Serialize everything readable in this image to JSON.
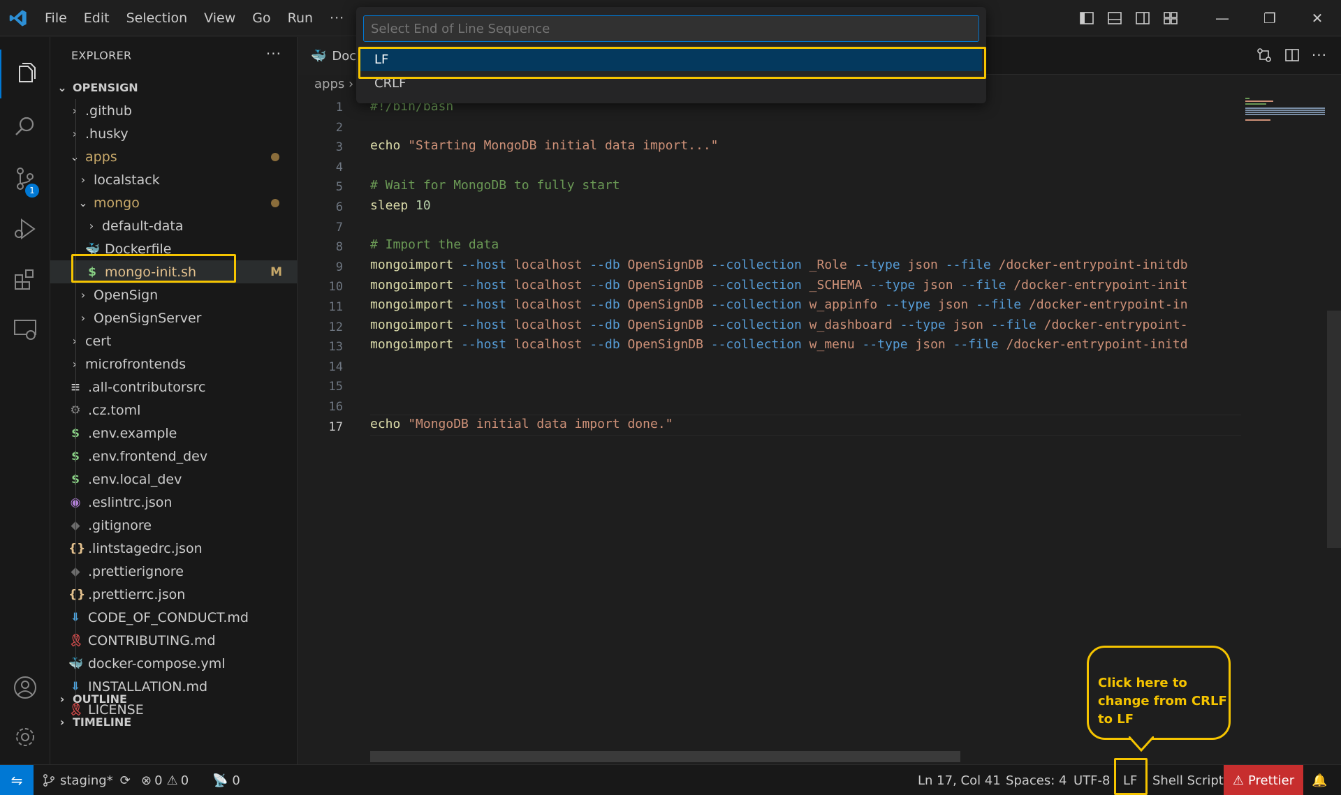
{
  "menu": [
    "File",
    "Edit",
    "Selection",
    "View",
    "Go",
    "Run"
  ],
  "menu_more": "···",
  "window": {
    "minimize": "—",
    "restore": "❐",
    "close": "✕"
  },
  "activity": {
    "scm_badge": "1"
  },
  "sidebar": {
    "title": "EXPLORER",
    "more": "···",
    "root": "OPENSIGN",
    "items": [
      {
        "label": ".github",
        "chev": "›",
        "icon": ""
      },
      {
        "label": ".husky",
        "chev": "›",
        "icon": ""
      },
      {
        "label": "apps",
        "chev": "⌄",
        "icon": ""
      },
      {
        "label": "localstack",
        "chev": "›",
        "icon": ""
      },
      {
        "label": "mongo",
        "chev": "⌄",
        "icon": ""
      },
      {
        "label": "default-data",
        "chev": "›",
        "icon": ""
      },
      {
        "label": "Dockerfile",
        "chev": "",
        "icon": "🐳"
      },
      {
        "label": "mongo-init.sh",
        "chev": "",
        "icon": "$",
        "status": "M"
      },
      {
        "label": "OpenSign",
        "chev": "›",
        "icon": ""
      },
      {
        "label": "OpenSignServer",
        "chev": "›",
        "icon": ""
      },
      {
        "label": "cert",
        "chev": "›",
        "icon": ""
      },
      {
        "label": "microfrontends",
        "chev": "›",
        "icon": ""
      },
      {
        "label": ".all-contributorsrc",
        "chev": "",
        "icon": "≡"
      },
      {
        "label": ".cz.toml",
        "chev": "",
        "icon": "⚙"
      },
      {
        "label": ".env.example",
        "chev": "",
        "icon": "$"
      },
      {
        "label": ".env.frontend_dev",
        "chev": "",
        "icon": "$"
      },
      {
        "label": ".env.local_dev",
        "chev": "",
        "icon": "$"
      },
      {
        "label": ".eslintrc.json",
        "chev": "",
        "icon": "◉"
      },
      {
        "label": ".gitignore",
        "chev": "",
        "icon": "◆"
      },
      {
        "label": ".lintstagedrc.json",
        "chev": "",
        "icon": "{}"
      },
      {
        "label": ".prettierignore",
        "chev": "",
        "icon": "◆"
      },
      {
        "label": ".prettierrc.json",
        "chev": "",
        "icon": "{}"
      },
      {
        "label": "CODE_OF_CONDUCT.md",
        "chev": "",
        "icon": "⬇"
      },
      {
        "label": "CONTRIBUTING.md",
        "chev": "",
        "icon": "🎗"
      },
      {
        "label": "docker-compose.yml",
        "chev": "",
        "icon": "🐳"
      },
      {
        "label": "INSTALLATION.md",
        "chev": "",
        "icon": "⬇"
      },
      {
        "label": "LICENSE",
        "chev": "",
        "icon": "🎗"
      }
    ],
    "outline": "OUTLINE",
    "timeline": "TIMELINE"
  },
  "tab": {
    "label": "Doc"
  },
  "breadcrumb": "apps ›",
  "quickpick": {
    "placeholder": "Select End of Line Sequence",
    "options": [
      "LF",
      "CRLF"
    ]
  },
  "code": {
    "line_numbers": [
      "1",
      "2",
      "3",
      "4",
      "5",
      "6",
      "7",
      "8",
      "9",
      "10",
      "11",
      "12",
      "13",
      "14",
      "15",
      "16",
      "17"
    ],
    "line1": "#!/bin/bash",
    "echo1_cmd": "echo",
    "echo1_str": "\"Starting MongoDB initial data import...\"",
    "comment1": "# Wait for MongoDB to fully start",
    "sleep_cmd": "sleep",
    "sleep_val": "10",
    "comment2": "# Import the data",
    "imports": [
      {
        "cmd": "mongoimport",
        "coll": "_Role",
        "tail": "/docker-entrypoint-initdb"
      },
      {
        "cmd": "mongoimport",
        "coll": "_SCHEMA",
        "tail": "/docker-entrypoint-init"
      },
      {
        "cmd": "mongoimport",
        "coll": "w_appinfo",
        "tail": "/docker-entrypoint-in"
      },
      {
        "cmd": "mongoimport",
        "coll": "w_dashboard",
        "tail": "/docker-entrypoint-"
      },
      {
        "cmd": "mongoimport",
        "coll": "w_menu",
        "tail": "/docker-entrypoint-initd"
      }
    ],
    "flag_host": "--host",
    "arg_host": "localhost",
    "flag_db": "--db",
    "arg_db": "OpenSignDB",
    "flag_coll": "--collection",
    "flag_type": "--type",
    "arg_type": "json",
    "flag_file": "--file",
    "echo2_cmd": "echo",
    "echo2_str": "\"MongoDB initial data import done.\""
  },
  "callout": "Click here to change from CRLF to LF",
  "status": {
    "branch": "staging*",
    "errors": "0",
    "warnings": "0",
    "ports": "0",
    "position": "Ln 17, Col 41",
    "spaces": "Spaces: 4",
    "encoding": "UTF-8",
    "eol": "LF",
    "language": "Shell Script",
    "prettier": "Prettier"
  },
  "colors": {
    "accent": "#0078d4",
    "highlight": "#f5c400",
    "prettier_bg": "#c72e2e"
  }
}
